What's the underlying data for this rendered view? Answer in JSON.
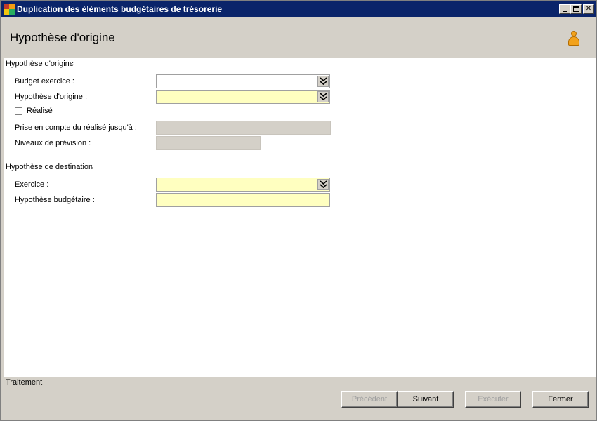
{
  "window": {
    "title": "Duplication des éléments budgétaires de trésorerie"
  },
  "header": {
    "title": "Hypothèse d'origine"
  },
  "origin_section": {
    "title": "Hypothèse d'origine",
    "budget_exercice_label": "Budget exercice :",
    "budget_exercice_value": "",
    "hypothese_origine_label": "Hypothèse d'origine :",
    "hypothese_origine_value": "",
    "realise_label": "Réalisé",
    "realise_checked": false,
    "prise_en_compte_label": "Prise en compte du réalisé jusqu'à :",
    "prise_en_compte_value": "",
    "niveaux_label": "Niveaux de prévision :",
    "niveaux_value": ""
  },
  "destination_section": {
    "title": "Hypothèse de destination",
    "exercice_label": "Exercice :",
    "exercice_value": "",
    "hypothese_budgetaire_label": "Hypothèse budgétaire :",
    "hypothese_budgetaire_value": ""
  },
  "footer": {
    "section_title": "Traitement",
    "prev_label": "Précédent",
    "next_label": "Suivant",
    "exec_label": "Exécuter",
    "close_label": "Fermer"
  },
  "icons": {
    "app": "app-icon",
    "user": "user-icon",
    "dropdown": "double-chevron-down-icon"
  },
  "colors": {
    "titlebar": "#0a246a",
    "required_field": "#ffffc0",
    "disabled_field": "#d4d0c8",
    "user_icon": "#f2a21c"
  }
}
